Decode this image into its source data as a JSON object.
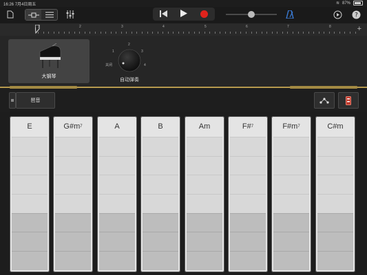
{
  "status": {
    "time": "16:26",
    "date": "7月4日周五",
    "battery": "87%",
    "battery_fraction": 0.87
  },
  "toolbar": {
    "icons": [
      "document-icon",
      "tracks-view-icon",
      "browser-view-icon",
      "mixer-icon"
    ],
    "transport": [
      "rewind-icon",
      "play-icon",
      "record-icon"
    ],
    "volume_level": 0.5,
    "right_icons": [
      "metronome-icon",
      "loop-icon",
      "help-icon"
    ]
  },
  "ruler": {
    "marks": [
      "1",
      "2",
      "3",
      "4",
      "5",
      "6",
      "7",
      "8"
    ]
  },
  "instrument": {
    "name": "大钢琴"
  },
  "autoplay": {
    "label": "自动弹奏",
    "positions": [
      "关闭",
      "1",
      "2",
      "3",
      "4"
    ]
  },
  "controls": {
    "chord_button": "琶音"
  },
  "chords": [
    {
      "root": "E",
      "sup": ""
    },
    {
      "root": "G#m",
      "sup": "7"
    },
    {
      "root": "A",
      "sup": ""
    },
    {
      "root": "B",
      "sup": ""
    },
    {
      "root": "Am",
      "sup": ""
    },
    {
      "root": "F#",
      "sup": "7"
    },
    {
      "root": "F#m",
      "sup": "7"
    },
    {
      "root": "C#m",
      "sup": ""
    }
  ],
  "colors": {
    "accent_gold": "#b69a4e",
    "record_red": "#e0231c",
    "metronome_blue": "#3a7bd5"
  }
}
